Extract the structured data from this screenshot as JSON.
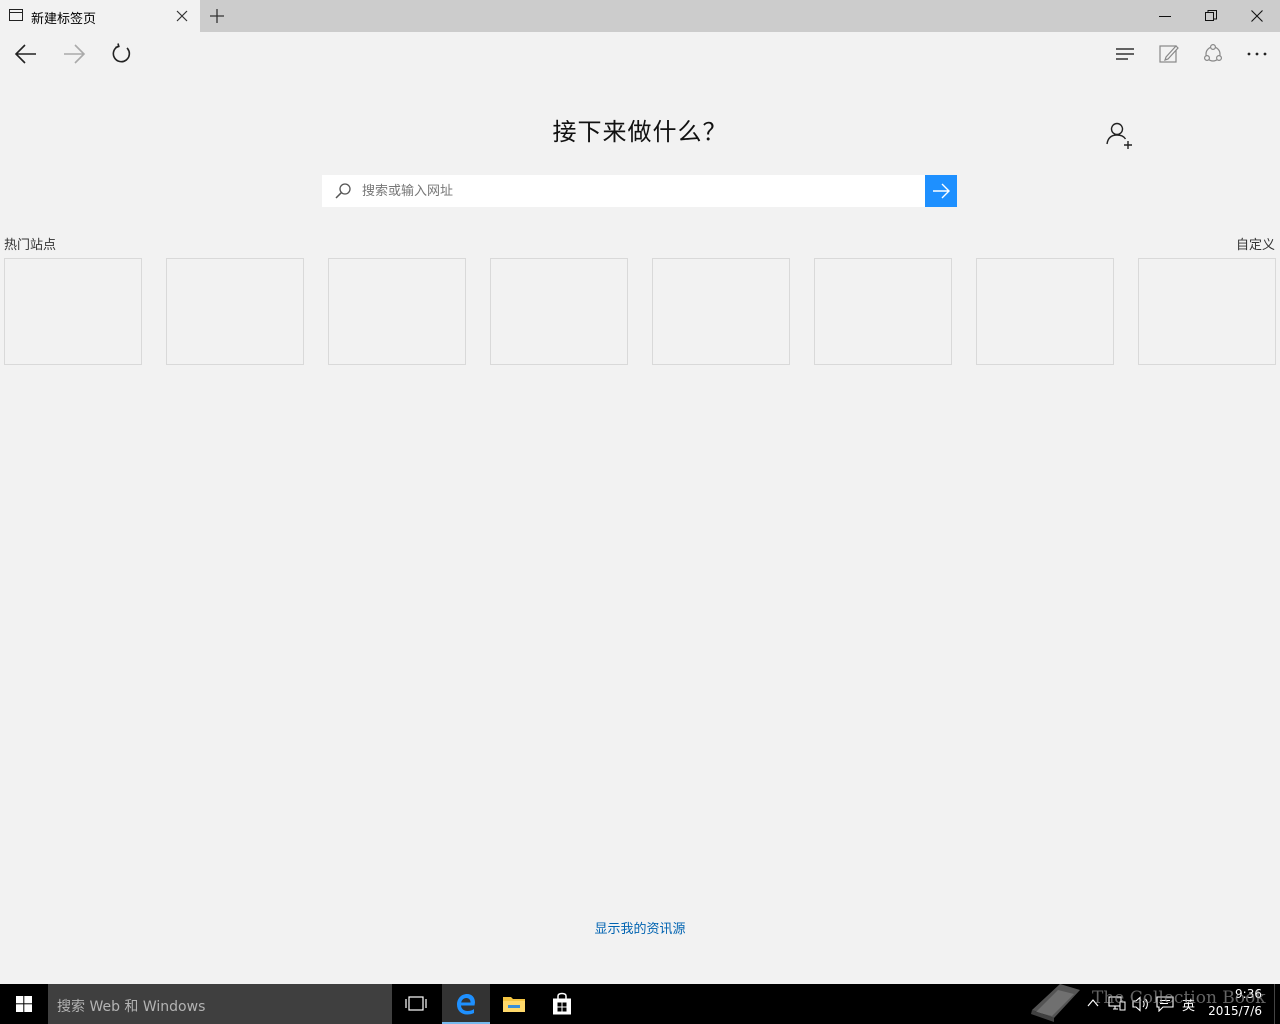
{
  "tab": {
    "title": "新建标签页"
  },
  "main": {
    "heading": "接下来做什么？",
    "search_placeholder": "搜索或输入网址",
    "top_sites_label": "热门站点",
    "customize_label": "自定义",
    "tiles": [
      "",
      "",
      "",
      "",
      "",
      "",
      "",
      ""
    ],
    "news_link": "显示我的资讯源"
  },
  "taskbar": {
    "search_text": "搜索 Web 和 Windows",
    "language": "英",
    "time": "9:36",
    "date": "2015/7/6"
  },
  "watermark": {
    "text": "The Collection Book"
  },
  "colors": {
    "accent": "#1e90ff",
    "link": "#0063b1",
    "page_bg": "#f2f2f2",
    "titlebar_bg": "#cccccc",
    "taskbar_bg": "#000000"
  },
  "icons": {
    "tab": "tab-page-icon",
    "close_tab": "close-icon",
    "new_tab": "plus-icon",
    "back": "arrow-left-icon",
    "forward": "arrow-right-icon",
    "refresh": "refresh-icon",
    "hub": "hub-icon",
    "web_note": "pen-icon",
    "share": "share-icon",
    "more": "ellipsis-icon",
    "add_user": "add-user-icon",
    "search": "search-icon",
    "go": "arrow-right-icon"
  }
}
